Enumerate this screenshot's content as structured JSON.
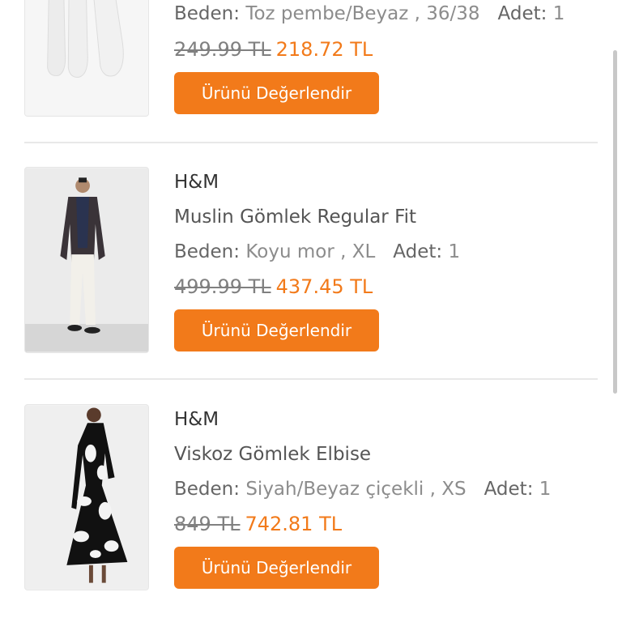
{
  "items": [
    {
      "image_icon": "socks-photo",
      "brand": "",
      "name": "",
      "size_label": "Beden:",
      "size_value": "Toz pembe/Beyaz , 36/38",
      "qty_label": "Adet:",
      "qty_value": "1",
      "old_price": "249.99 TL",
      "new_price": "218.72 TL",
      "button_label": "Ürünü Değerlendir"
    },
    {
      "image_icon": "man-shirt-photo",
      "brand": "H&M",
      "name": "Muslin Gömlek Regular Fit",
      "size_label": "Beden:",
      "size_value": "Koyu mor , XL",
      "qty_label": "Adet:",
      "qty_value": "1",
      "old_price": "499.99 TL",
      "new_price": "437.45 TL",
      "button_label": "Ürünü Değerlendir"
    },
    {
      "image_icon": "floral-dress-photo",
      "brand": "H&M",
      "name": "Viskoz Gömlek Elbise",
      "size_label": "Beden:",
      "size_value": "Siyah/Beyaz çiçekli , XS",
      "qty_label": "Adet:",
      "qty_value": "1",
      "old_price": "849 TL",
      "new_price": "742.81 TL",
      "button_label": "Ürünü Değerlendir"
    }
  ],
  "colors": {
    "accent": "#f27a1a",
    "old_price": "#808080",
    "text": "#555555",
    "divider": "#e8e8e8"
  }
}
